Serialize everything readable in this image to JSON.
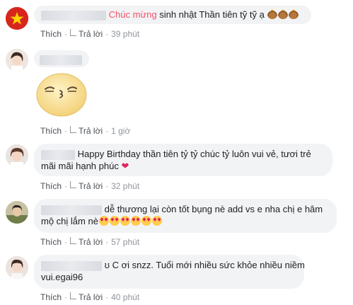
{
  "actions": {
    "like": "Thích",
    "reply": "Trả lời"
  },
  "comments": [
    {
      "text_highlight": "Chúc mừng",
      "text": "sinh nhật Thần tiên tỹ tỹ ạ",
      "time": "39 phút"
    },
    {
      "time": "1 giờ"
    },
    {
      "text_line1": "Happy Birthday thần tiên tỷ tỷ chúc tỷ luôn vui vẻ, tươi trẻ",
      "text_line2": "mãi mãi hạnh phúc",
      "time": "32 phút"
    },
    {
      "text_line1": "dễ thương lại còn tốt bụng nè add vs e nha chị e hâm",
      "text_line2": "mộ chị lắm nè",
      "time": "57 phút"
    },
    {
      "text_line1": "ʊ C ơi snzz. Tuổi mới nhiều sức khỏe nhiều niềm",
      "text_line2": "vui.egai96",
      "time": "40 phút"
    }
  ],
  "icons": [
    "flag-avatar",
    "reply-arrow-icon",
    "cake-emoji",
    "heart-icon",
    "heart-eyes-emoji",
    "blushing-kiss-sticker"
  ],
  "colors": {
    "bubble": "#f2f3f5",
    "link": "#4b4f56",
    "muted": "#90949c",
    "wow": "#f35369"
  }
}
